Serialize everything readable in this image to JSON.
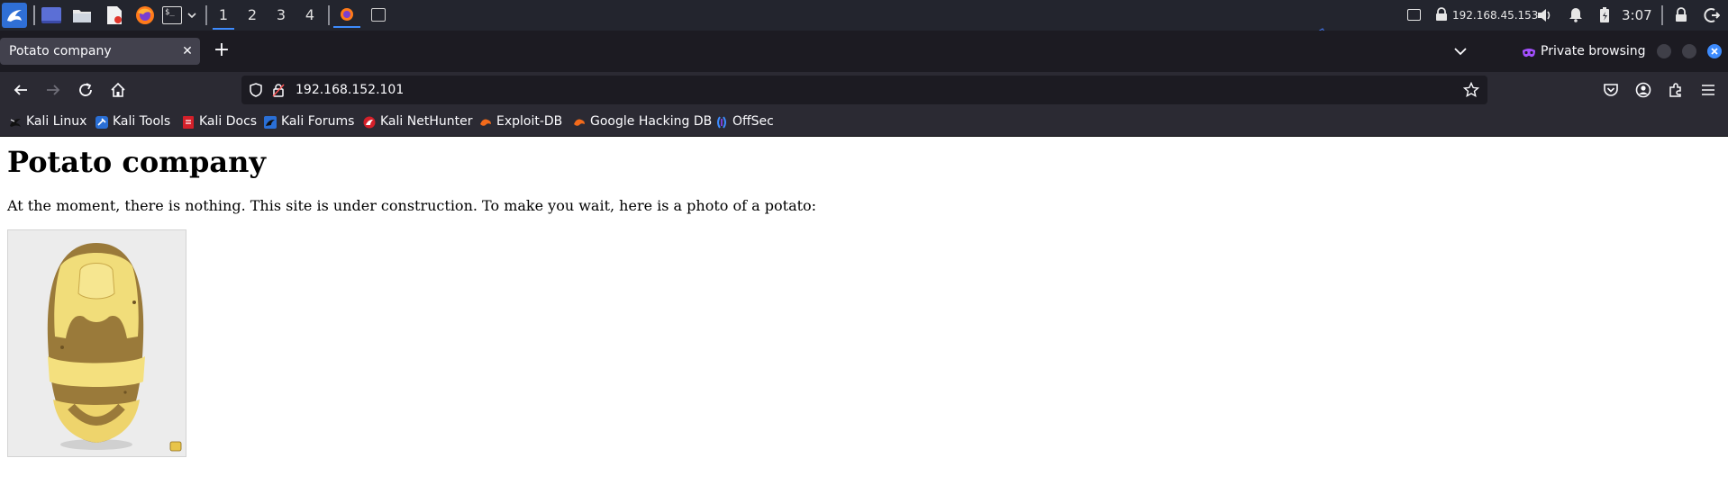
{
  "taskbar": {
    "workspaces": [
      "1",
      "2",
      "3",
      "4"
    ],
    "active_workspace": "1",
    "ip_address": "192.168.45.153",
    "clock": "3:07"
  },
  "browser": {
    "tab_title": "Potato company",
    "private_label": "Private browsing",
    "url": "192.168.152.101",
    "accent_color": "#3d8bfd",
    "private_color": "#a450ff"
  },
  "bookmarks": [
    {
      "label": "Kali Linux",
      "icon": "kali-dragon-icon"
    },
    {
      "label": "Kali Tools",
      "icon": "kali-tools-icon"
    },
    {
      "label": "Kali Docs",
      "icon": "kali-docs-icon"
    },
    {
      "label": "Kali Forums",
      "icon": "kali-forums-icon"
    },
    {
      "label": "Kali NetHunter",
      "icon": "nethunter-icon"
    },
    {
      "label": "Exploit-DB",
      "icon": "exploit-db-icon"
    },
    {
      "label": "Google Hacking DB",
      "icon": "ghdb-icon"
    },
    {
      "label": "OffSec",
      "icon": "offsec-icon"
    }
  ],
  "page": {
    "heading": "Potato company",
    "body": "At the moment, there is nothing. This site is under construction. To make you wait, here is a photo of a potato:"
  }
}
